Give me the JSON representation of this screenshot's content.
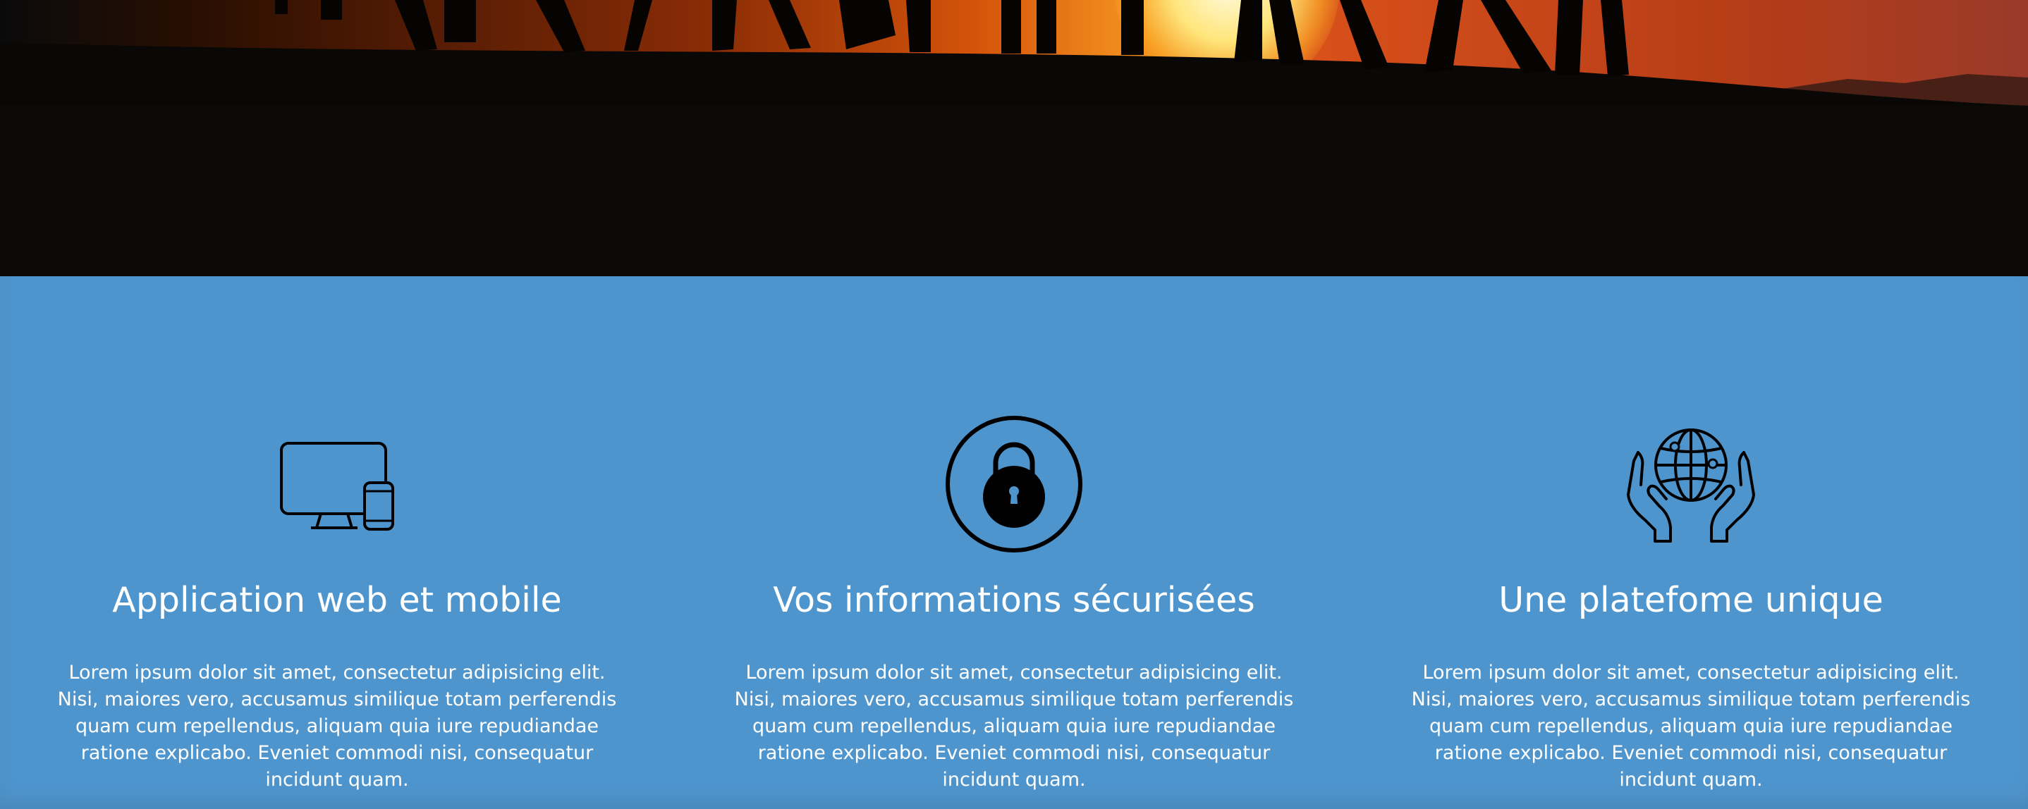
{
  "hero": {
    "image": "silhouette-group-sunset"
  },
  "features": [
    {
      "icon": "devices-icon",
      "title": "Application web et mobile",
      "text": "Lorem ipsum dolor sit amet, consectetur adipisicing elit. Nisi, maiores vero, accusamus similique totam perferendis quam cum repellendus, aliquam quia iure repudiandae ratione explicabo. Eveniet commodi nisi, consequatur incidunt quam."
    },
    {
      "icon": "lock-icon",
      "title": "Vos informations sécurisées",
      "text": "Lorem ipsum dolor sit amet, consectetur adipisicing elit. Nisi, maiores vero, accusamus similique totam perferendis quam cum repellendus, aliquam quia iure repudiandae ratione explicabo. Eveniet commodi nisi, consequatur incidunt quam."
    },
    {
      "icon": "globe-hands-icon",
      "title": "Une platefome unique",
      "text": "Lorem ipsum dolor sit amet, consectetur adipisicing elit. Nisi, maiores vero, accusamus similique totam perferendis quam cum repellendus, aliquam quia iure repudiandae ratione explicabo. Eveniet commodi nisi, consequatur incidunt quam."
    }
  ],
  "colors": {
    "band": "#4f95cd",
    "icon": "#000000",
    "text": "#ffffff"
  }
}
